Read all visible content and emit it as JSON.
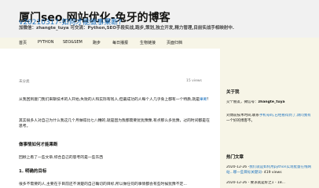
{
  "header": {
    "site_title": "厦门seo,网站优化-兔牙的博客",
    "site_desc": "加微信：zhangte_tuya 可交流：Python,SEO手段实战,跑步,策划,独立开发,精力管理,目前实战手相映射中."
  },
  "nav": {
    "items": [
      "首页",
      "PYTHON",
      "SEO&SEM",
      "跑步",
      "每日播报",
      "生物链接",
      "页面归档"
    ]
  },
  "post": {
    "title": "v20210317-如何才能做事果断?",
    "category": "未分类",
    "views": "15 views",
    "para1_link": "兔子",
    "para1": "从我回到厦门我们来聊技术的人开始,失败的人和实际有钱人,但最成功的人每个人几乎身上都有一个特质,就是",
    "para1_tail": "果断",
    "para2_a": "其实很多人对此自己就有点果断，",
    "para2_link": "兔子",
    "para2_b": "其实很多人对自己为什么我这几个月做得比七八糟的,就是因为我都需要犹犹豫豫,有点那么多犹豫，过的时间都是在思考。",
    "heading1": "做事情如何才能果断",
    "para3": "回顾上看了一些文章,综合自己的思考的是一些东西",
    "heading2": "1. 明确的目标",
    "para4": "很多不需要的人,主要在于目前还不清楚的自己确切的目标,所以做任何的事情都会有些时候犹豫不定..."
  },
  "sidebar": {
    "about_title": "关于我",
    "about_line1_prefix": "交个朋友，微信号：",
    "about_wechat": "zhangte_tuya",
    "about_line2_a": "刘博前技术时间,联系",
    "about_line2_b": "手机号码,已经看得到了,请问我有",
    "about_line2_c": "一个好的博客不。",
    "recent_title": "热门文章",
    "recent_date": "2020-12-26 -",
    "recent_link": "我们就是如何用python实现批量在线网站...哪一些目标关键词",
    "recent_views": "- 419 views",
    "recent_line2": "2020-12-26 - 要求就是好之1 - 18..."
  }
}
